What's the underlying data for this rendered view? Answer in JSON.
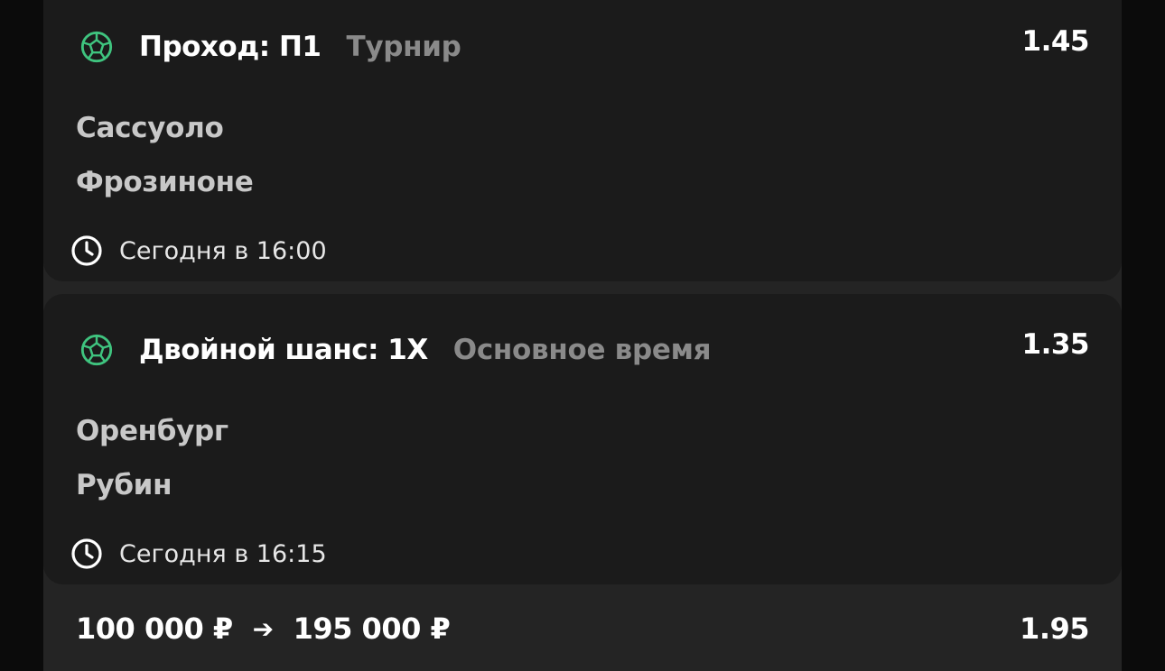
{
  "colors": {
    "background": "#0b0b0b",
    "panel": "#242424",
    "card": "#1b1b1b",
    "accent_ball": "#3fc47f",
    "text_primary": "#ffffff",
    "text_muted": "#8a8a8a"
  },
  "bets": [
    {
      "sport_icon": "soccer-ball-icon",
      "market": "Проход: П1",
      "period": "Турнир",
      "odd": "1.45",
      "team1": "Сассуоло",
      "team2": "Фрозиноне",
      "time_icon": "clock-icon",
      "time": "Сегодня в 16:00"
    },
    {
      "sport_icon": "soccer-ball-icon",
      "market": "Двойной шанс: 1X",
      "period": "Основное время",
      "odd": "1.35",
      "team1": "Оренбург",
      "team2": "Рубин",
      "time_icon": "clock-icon",
      "time": "Сегодня в 16:15"
    }
  ],
  "summary": {
    "stake": "100 000 ₽",
    "arrow": "➔",
    "payout": "195 000 ₽",
    "total_odd": "1.95"
  }
}
